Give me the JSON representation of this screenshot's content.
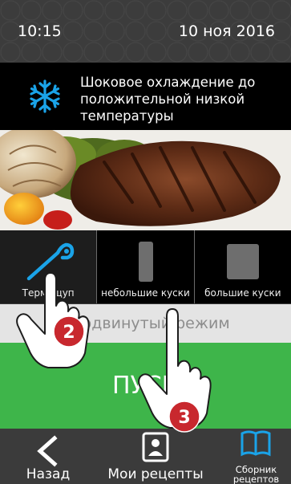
{
  "status_bar": {
    "time": "10:15",
    "date": "10 ноя 2016"
  },
  "header": {
    "icon": "snowflake-icon",
    "title": "Шоковое охлаждение до положительной низкой температуры",
    "accent_color": "#1aa3e8"
  },
  "tiles": [
    {
      "label": "Термощуп",
      "icon": "temperature-probe-icon",
      "selected": true
    },
    {
      "label": "небольшие куски",
      "icon": "small-pieces-icon",
      "selected": false
    },
    {
      "label": "большие куски",
      "icon": "large-pieces-icon",
      "selected": false
    }
  ],
  "advanced_mode": {
    "label": "Продвинутый режим"
  },
  "start_button": {
    "label": "ПУСК",
    "color": "#3eb54a"
  },
  "bottom_nav": {
    "back": {
      "label": "Назад",
      "icon": "chevron-left-icon"
    },
    "my_recipes": {
      "label": "Мои рецепты",
      "icon": "recipe-card-icon"
    },
    "recipe_collection": {
      "label": "Сборник рецептов",
      "icon": "book-icon"
    }
  },
  "hints": [
    {
      "number": "2",
      "color": "#c8282e"
    },
    {
      "number": "3",
      "color": "#c8282e"
    }
  ]
}
